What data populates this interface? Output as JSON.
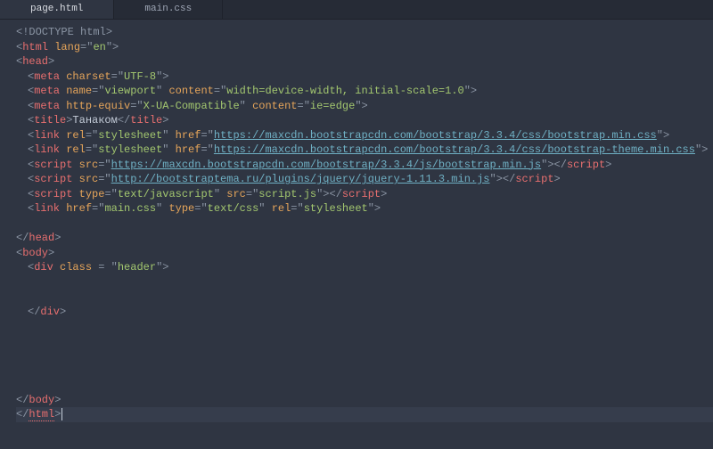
{
  "tabs": {
    "active": "page.html",
    "inactive": "main.css"
  },
  "code": {
    "doctype": "DOCTYPE html",
    "html_tag": "html",
    "lang_attr": "lang",
    "lang_val": "en",
    "head_tag": "head",
    "meta_tag": "meta",
    "charset_attr": "charset",
    "charset_val": "UTF-8",
    "name_attr": "name",
    "viewport_val": "viewport",
    "content_attr": "content",
    "viewport_content": "width=device-width, initial-scale=1.0",
    "http_equiv_attr": "http-equiv",
    "xua_val": "X-UA-Compatible",
    "ie_edge": "ie=edge",
    "title_tag": "title",
    "title_text": "Танаком",
    "link_tag": "link",
    "rel_attr": "rel",
    "stylesheet_val": "stylesheet",
    "href_attr": "href",
    "url1": "https://maxcdn.bootstrapcdn.com/bootstrap/3.3.4/css/bootstrap.min.css",
    "url2": "https://maxcdn.bootstrapcdn.com/bootstrap/3.3.4/css/bootstrap-theme.min.css",
    "script_tag": "script",
    "src_attr": "src",
    "url3": "https://maxcdn.bootstrapcdn.com/bootstrap/3.3.4/js/bootstrap.min.js",
    "url4": "http://bootstraptema.ru/plugins/jquery/jquery-1.11.3.min.js",
    "type_attr": "type",
    "text_js": "text/javascript",
    "script_js": "script.js",
    "main_css": "main.css",
    "text_css": "text/css",
    "body_tag": "body",
    "div_tag": "div",
    "class_attr": "class",
    "header_val": "header"
  }
}
